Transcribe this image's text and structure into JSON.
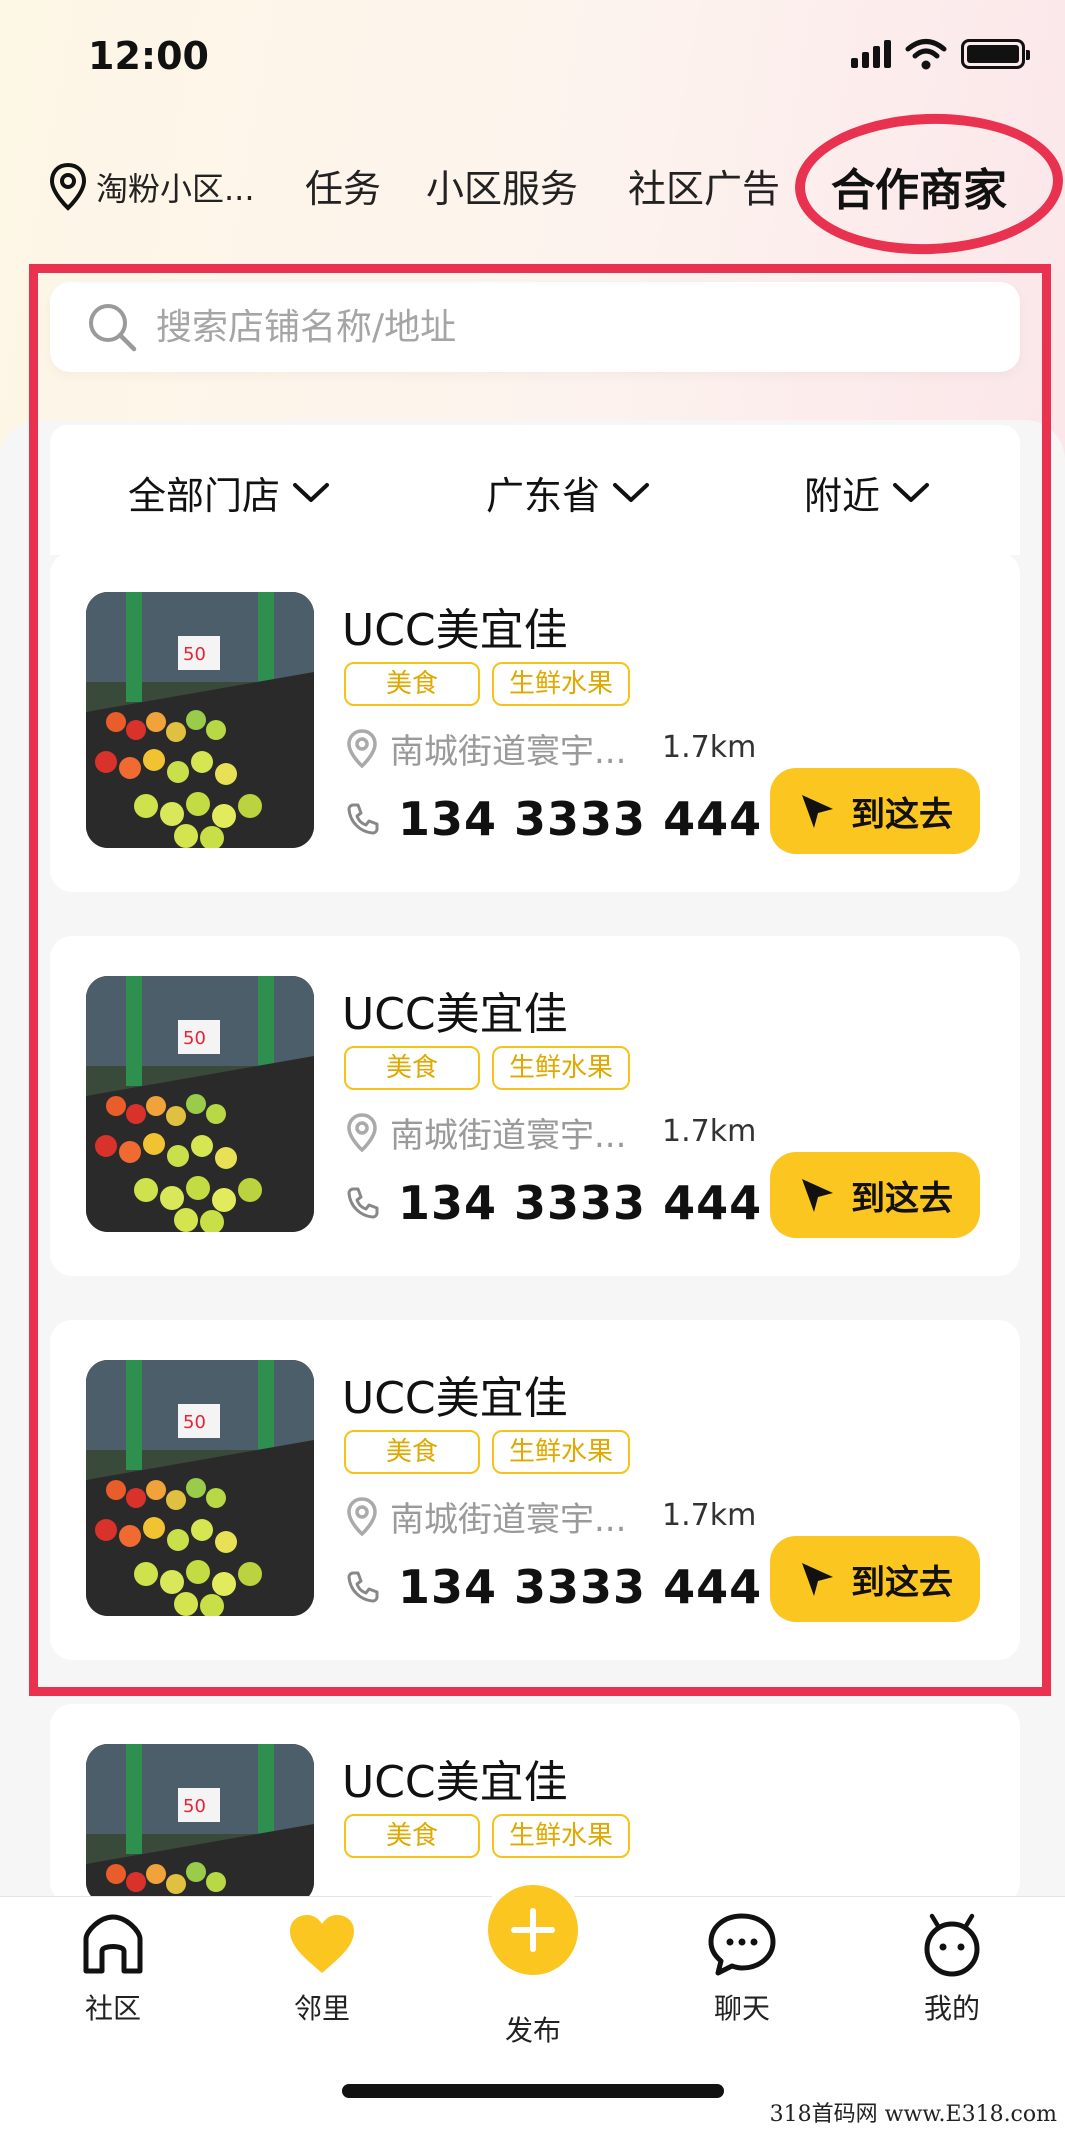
{
  "status_bar": {
    "time": "12:00"
  },
  "nav": {
    "location": "淘粉小区...",
    "tabs": [
      "任务",
      "小区服务",
      "社区广告",
      "合作商家"
    ],
    "active_tab": "合作商家"
  },
  "search": {
    "placeholder": "搜索店铺名称/地址"
  },
  "filters": {
    "store_type": "全部门店",
    "province": "广东省",
    "range": "附近"
  },
  "stores": [
    {
      "name": "UCC美宜佳",
      "tags": [
        "美食",
        "生鲜水果"
      ],
      "address": "南城街道寰宇...",
      "distance": "1.7km",
      "phone": "134 3333 444",
      "button": "到这去"
    },
    {
      "name": "UCC美宜佳",
      "tags": [
        "美食",
        "生鲜水果"
      ],
      "address": "南城街道寰宇...",
      "distance": "1.7km",
      "phone": "134 3333 444",
      "button": "到这去"
    },
    {
      "name": "UCC美宜佳",
      "tags": [
        "美食",
        "生鲜水果"
      ],
      "address": "南城街道寰宇...",
      "distance": "1.7km",
      "phone": "134 3333 444",
      "button": "到这去"
    },
    {
      "name": "UCC美宜佳",
      "tags": [
        "美食",
        "生鲜水果"
      ]
    }
  ],
  "bottom_nav": {
    "items": [
      {
        "label": "社区",
        "icon": "home-icon"
      },
      {
        "label": "邻里",
        "icon": "heart-icon"
      },
      {
        "label": "发布",
        "icon": "plus-icon"
      },
      {
        "label": "聊天",
        "icon": "chat-icon"
      },
      {
        "label": "我的",
        "icon": "profile-icon"
      }
    ]
  },
  "watermark": "318首码网 www.E318.com",
  "colors": {
    "accent": "#fcc620",
    "highlight_red": "#e8324f",
    "tag_text": "#e0a800"
  }
}
